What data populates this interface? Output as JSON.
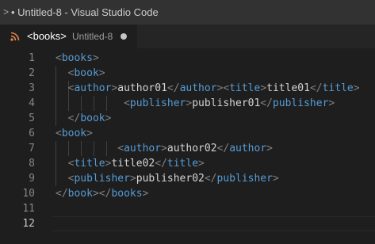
{
  "window": {
    "title": "• Untitled-8 - Visual Studio Code",
    "menu_chevron": ">"
  },
  "tab": {
    "icon": "rss-icon",
    "name": "<books>",
    "description": "Untitled-8",
    "dirty": true
  },
  "editor": {
    "active_line": 12,
    "lines": [
      {
        "number": "1",
        "tokens": [
          [
            "p",
            "<"
          ],
          [
            "t",
            "books"
          ],
          [
            "p",
            ">"
          ]
        ]
      },
      {
        "number": "2",
        "tokens": [
          [
            "x",
            "  "
          ],
          [
            "p",
            "<"
          ],
          [
            "t",
            "book"
          ],
          [
            "p",
            ">"
          ]
        ]
      },
      {
        "number": "3",
        "tokens": [
          [
            "x",
            "  "
          ],
          [
            "p",
            "<"
          ],
          [
            "t",
            "author"
          ],
          [
            "p",
            ">"
          ],
          [
            "x",
            "author01"
          ],
          [
            "p",
            "</"
          ],
          [
            "t",
            "author"
          ],
          [
            "p",
            ">"
          ],
          [
            "p",
            "<"
          ],
          [
            "t",
            "title"
          ],
          [
            "p",
            ">"
          ],
          [
            "x",
            "title01"
          ],
          [
            "p",
            "</"
          ],
          [
            "t",
            "title"
          ],
          [
            "p",
            ">"
          ]
        ]
      },
      {
        "number": "4",
        "tokens": [
          [
            "x",
            "           "
          ],
          [
            "p",
            "<"
          ],
          [
            "t",
            "publisher"
          ],
          [
            "p",
            ">"
          ],
          [
            "x",
            "publisher01"
          ],
          [
            "p",
            "</"
          ],
          [
            "t",
            "publisher"
          ],
          [
            "p",
            ">"
          ]
        ]
      },
      {
        "number": "5",
        "tokens": [
          [
            "x",
            "  "
          ],
          [
            "p",
            "</"
          ],
          [
            "t",
            "book"
          ],
          [
            "p",
            ">"
          ]
        ]
      },
      {
        "number": "6",
        "tokens": [
          [
            "p",
            "<"
          ],
          [
            "t",
            "book"
          ],
          [
            "p",
            ">"
          ]
        ]
      },
      {
        "number": "7",
        "tokens": [
          [
            "x",
            "          "
          ],
          [
            "p",
            "<"
          ],
          [
            "t",
            "author"
          ],
          [
            "p",
            ">"
          ],
          [
            "x",
            "author02"
          ],
          [
            "p",
            "</"
          ],
          [
            "t",
            "author"
          ],
          [
            "p",
            ">"
          ]
        ]
      },
      {
        "number": "8",
        "tokens": [
          [
            "x",
            "  "
          ],
          [
            "p",
            "<"
          ],
          [
            "t",
            "title"
          ],
          [
            "p",
            ">"
          ],
          [
            "x",
            "title02"
          ],
          [
            "p",
            "</"
          ],
          [
            "t",
            "title"
          ],
          [
            "p",
            ">"
          ]
        ]
      },
      {
        "number": "9",
        "tokens": [
          [
            "x",
            "  "
          ],
          [
            "p",
            "<"
          ],
          [
            "t",
            "publisher"
          ],
          [
            "p",
            ">"
          ],
          [
            "x",
            "publisher02"
          ],
          [
            "p",
            "</"
          ],
          [
            "t",
            "publisher"
          ],
          [
            "p",
            ">"
          ]
        ]
      },
      {
        "number": "10",
        "tokens": [
          [
            "p",
            "</"
          ],
          [
            "t",
            "book"
          ],
          [
            "p",
            ">"
          ],
          [
            "p",
            "</"
          ],
          [
            "t",
            "books"
          ],
          [
            "p",
            ">"
          ]
        ]
      },
      {
        "number": "11",
        "tokens": []
      },
      {
        "number": "12",
        "tokens": []
      }
    ]
  },
  "colors": {
    "tag": "#569cd6",
    "punctuation": "#808080",
    "text": "#d4d4d4",
    "background": "#1e1e1e",
    "rss_icon": "#e8864a"
  }
}
